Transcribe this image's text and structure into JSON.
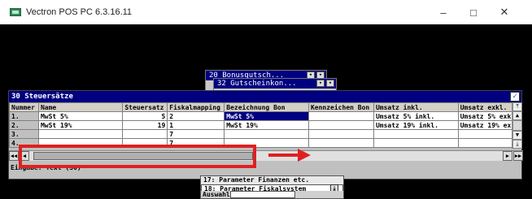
{
  "window": {
    "title": "Vectron POS PC 6.3.16.11",
    "min_glyph": "–",
    "max_glyph": "□",
    "close_glyph": "✕"
  },
  "bg_windows": [
    {
      "title": "20 Bonusgutsch..."
    },
    {
      "title": "32 Gutscheinkon..."
    }
  ],
  "dialog": {
    "title": "30 Steuersätze",
    "ok_glyph": "✓",
    "columns": [
      "Nummer",
      "Name",
      "Steuersatz",
      "Fiskalmapping",
      "Bezeichnung Bon",
      "Kennzeichen Bon",
      "Umsatz inkl.",
      "Umsatz exkl."
    ],
    "rows": [
      {
        "nr": "1.",
        "name": "MwSt 5%",
        "satz": "5",
        "fiskal": "2",
        "bez": "MwSt 5%",
        "kenn": "",
        "inkl": "Umsatz  5% inkl.",
        "exkl": "Umsatz  5% exkl"
      },
      {
        "nr": "2.",
        "name": "MwSt 19%",
        "satz": "19",
        "fiskal": "1",
        "bez": "MwSt 19%",
        "kenn": "",
        "inkl": "Umsatz 19% inkl.",
        "exkl": "Umsatz 19% exkl"
      },
      {
        "nr": "3.",
        "name": "",
        "satz": "",
        "fiskal": "7",
        "bez": "",
        "kenn": "",
        "inkl": "",
        "exkl": ""
      },
      {
        "nr": "4.",
        "name": "",
        "satz": "",
        "fiskal": "7",
        "bez": "",
        "kenn": "",
        "inkl": "",
        "exkl": ""
      }
    ],
    "status": "Eingabe: Text (30)"
  },
  "menu": {
    "items": [
      "17: Parameter Finanzen etc.",
      "18: Parameter Fiskalsystem"
    ],
    "input_label": "Auswahl"
  }
}
